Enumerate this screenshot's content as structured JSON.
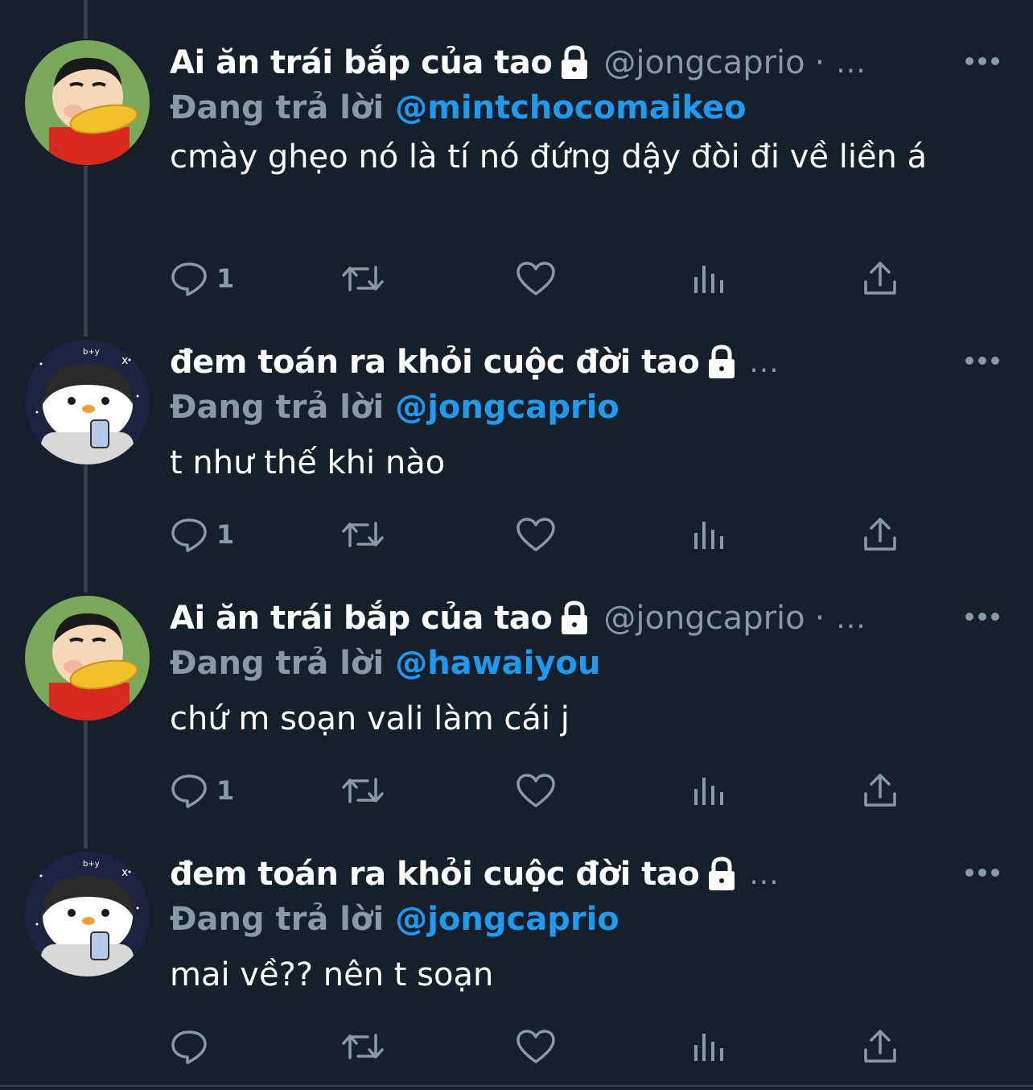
{
  "colors": {
    "background": "#15202b",
    "thread_line": "#38444d",
    "primary_text": "#ffffff",
    "secondary_text": "#8b98a5",
    "mention": "#1d9bf0"
  },
  "tweets": [
    {
      "avatar": "shinchan-avatar",
      "display_name": "Ai ăn trái bắp của tao",
      "handle": "@jongcaprio",
      "dot": "·",
      "timestamp": "...",
      "reply_label": "Đang trả lời",
      "reply_to": "@mintchocomaikeo",
      "text": "cmày ghẹo nó là tí nó đứng dậy đòi đi về liền á",
      "reply_count": "1"
    },
    {
      "avatar": "penguin-avatar",
      "display_name": "đem toán ra khỏi cuộc đời tao",
      "handle": "",
      "dot": "",
      "timestamp": "...",
      "reply_label": "Đang trả lời",
      "reply_to": "@jongcaprio",
      "text": "t như thế khi nào",
      "reply_count": "1"
    },
    {
      "avatar": "shinchan-avatar",
      "display_name": "Ai ăn trái bắp của tao",
      "handle": "@jongcaprio",
      "dot": "·",
      "timestamp": "...",
      "reply_label": "Đang trả lời",
      "reply_to": "@hawaiyou",
      "text": "chứ m soạn vali làm cái j",
      "reply_count": "1"
    },
    {
      "avatar": "penguin-avatar",
      "display_name": "đem toán ra khỏi cuộc đời tao",
      "handle": "",
      "dot": "",
      "timestamp": "...",
      "reply_label": "Đang trả lời",
      "reply_to": "@jongcaprio",
      "text": "mai về?? nên t soạn",
      "reply_count": ""
    }
  ],
  "icons": {
    "protected": "lock-icon",
    "more": "more-icon",
    "reply": "reply-icon",
    "retweet": "retweet-icon",
    "like": "heart-icon",
    "analytics": "analytics-icon",
    "share": "share-icon"
  }
}
